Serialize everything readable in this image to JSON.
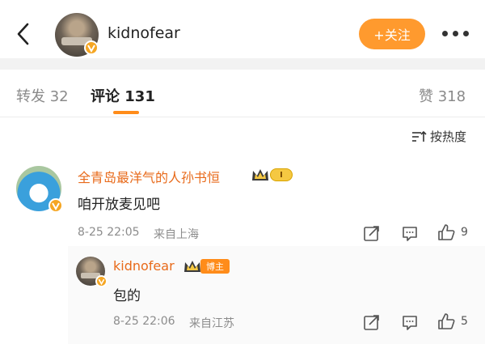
{
  "header": {
    "username": "kidnofear",
    "follow_label": "+关注",
    "accent": "#ff9a2e"
  },
  "tabs": {
    "repost": "转发 32",
    "comments": "评论 131",
    "likes": "赞 318"
  },
  "sort": {
    "label": "按热度"
  },
  "comments": [
    {
      "username": "全青岛最洋气的人孙书恒",
      "level_badge": "I",
      "text": "咱开放麦见吧",
      "date": "8-25 22:05",
      "location": "来自上海",
      "likes": "9"
    },
    {
      "username": "kidnofear",
      "author_badge": "博主",
      "text": "包的",
      "date": "8-25 22:06",
      "location": "来自江苏",
      "likes": "5"
    }
  ],
  "icons": {
    "back": "chevron-left-icon",
    "more": "more-dots-icon",
    "sort": "sort-icon",
    "share": "share-icon",
    "reply": "comment-icon",
    "like": "thumbs-up-icon",
    "verified": "verified-badge-icon",
    "crown": "crown-icon"
  }
}
